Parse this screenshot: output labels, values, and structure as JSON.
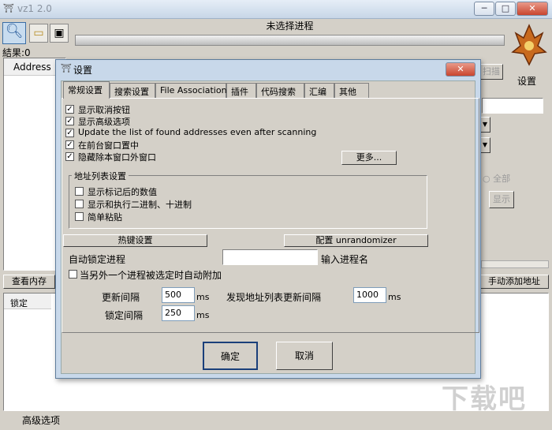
{
  "main": {
    "title": "vz1 2.0",
    "window_buttons": [
      "─",
      "□",
      "✕"
    ],
    "process_label": "未选择进程",
    "result_label": "結果:0",
    "address_header": "Address",
    "scan_btn": "扫描",
    "settings_label": "设置",
    "view_memory_btn": "查看内存",
    "manual_add_btn": "手动添加地址",
    "lock_header": "锁定",
    "advanced_options": "高级选项",
    "all_radio": "全部",
    "show_btn": "显示",
    "watermark": "下载吧"
  },
  "dialog": {
    "title": "设置",
    "close": "✕",
    "tabs": [
      "常规设置",
      "搜索设置",
      "File Associations",
      "插件",
      "代码搜索",
      "汇编",
      "其他"
    ],
    "options": [
      {
        "label": "显示取消按钮",
        "checked": true
      },
      {
        "label": "显示高级选项",
        "checked": true
      },
      {
        "label": "Update the list of found addresses even after scanning",
        "checked": true
      },
      {
        "label": "在前台窗口置中",
        "checked": true
      },
      {
        "label": "隐藏除本窗口外窗口",
        "checked": true
      }
    ],
    "more_btn": "更多...",
    "group_title": "地址列表设置",
    "group_options": [
      {
        "label": "显示标记后的数值",
        "checked": false
      },
      {
        "label": "显示和执行二进制、十进制",
        "checked": false
      },
      {
        "label": "简单粘贴",
        "checked": false
      }
    ],
    "hotkey_btn": "热键设置",
    "unrandom_btn": "配置 unrandomizer",
    "auto_lock_label": "自动锁定进程",
    "auto_lock_value": "",
    "input_process_label": "输入进程名",
    "auto_attach": {
      "label": "当另外一个进程被选定时自动附加",
      "checked": false
    },
    "update_interval_label": "更新间隔",
    "update_interval": "500",
    "ms1": "ms",
    "found_update_label": "发现地址列表更新间隔",
    "found_update": "1000",
    "ms2": "ms",
    "freeze_interval_label": "锁定间隔",
    "freeze_interval": "250",
    "ms3": "ms",
    "ok_btn": "确定",
    "cancel_btn": "取消"
  }
}
